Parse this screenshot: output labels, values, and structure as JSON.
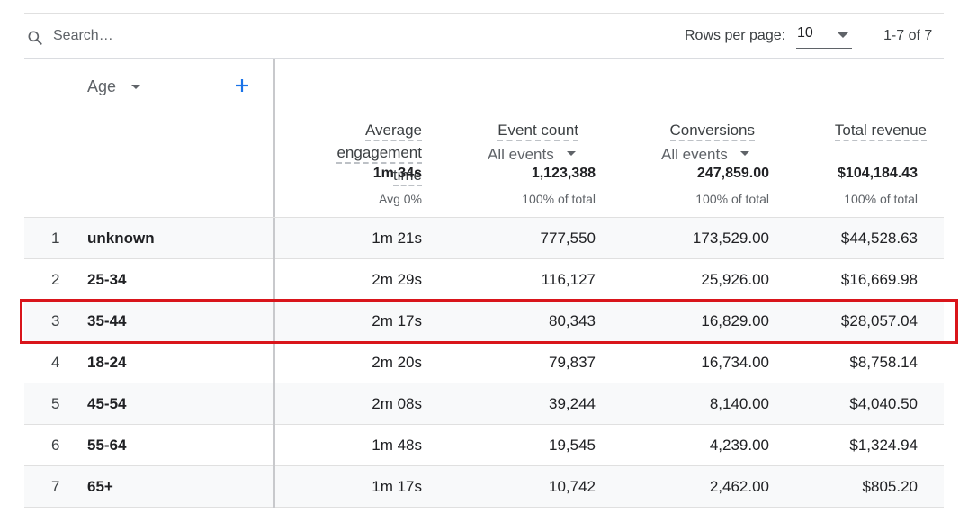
{
  "toolbar": {
    "search_placeholder": "Search…",
    "rows_per_page_label": "Rows per page:",
    "rows_per_page_value": "10",
    "range": "1-7 of 7"
  },
  "header": {
    "dimension": "Age",
    "metrics": {
      "avg_engagement": {
        "label_lines": [
          "Average",
          "engagement",
          "time"
        ],
        "total": "1m 34s",
        "total_sub": "Avg 0%"
      },
      "event_count": {
        "label_lines": [
          "Event count"
        ],
        "selector": "All events",
        "total": "1,123,388",
        "total_sub": "100% of total"
      },
      "conversions": {
        "label_lines": [
          "Conversions"
        ],
        "selector": "All events",
        "total": "247,859.00",
        "total_sub": "100% of total"
      },
      "total_revenue": {
        "label_lines": [
          "Total revenue"
        ],
        "total": "$104,184.43",
        "total_sub": "100% of total"
      }
    }
  },
  "rows": [
    {
      "idx": "1",
      "age": "unknown",
      "avg_time": "1m 21s",
      "events": "777,550",
      "conversions": "173,529.00",
      "revenue": "$44,528.63"
    },
    {
      "idx": "2",
      "age": "25-34",
      "avg_time": "2m 29s",
      "events": "116,127",
      "conversions": "25,926.00",
      "revenue": "$16,669.98"
    },
    {
      "idx": "3",
      "age": "35-44",
      "avg_time": "2m 17s",
      "events": "80,343",
      "conversions": "16,829.00",
      "revenue": "$28,057.04"
    },
    {
      "idx": "4",
      "age": "18-24",
      "avg_time": "2m 20s",
      "events": "79,837",
      "conversions": "16,734.00",
      "revenue": "$8,758.14"
    },
    {
      "idx": "5",
      "age": "45-54",
      "avg_time": "2m 08s",
      "events": "39,244",
      "conversions": "8,140.00",
      "revenue": "$4,040.50"
    },
    {
      "idx": "6",
      "age": "55-64",
      "avg_time": "1m 48s",
      "events": "19,545",
      "conversions": "4,239.00",
      "revenue": "$1,324.94"
    },
    {
      "idx": "7",
      "age": "65+",
      "avg_time": "1m 17s",
      "events": "10,742",
      "conversions": "2,462.00",
      "revenue": "$805.20"
    }
  ],
  "highlighted_row": "3",
  "colors": {
    "highlight": "#d9151b",
    "accent": "#1a73e8",
    "alt_row": "#f8f9fa"
  },
  "icons": {
    "search": "search-icon",
    "add_dimension": "plus-icon",
    "dropdown": "caret-down-icon"
  }
}
